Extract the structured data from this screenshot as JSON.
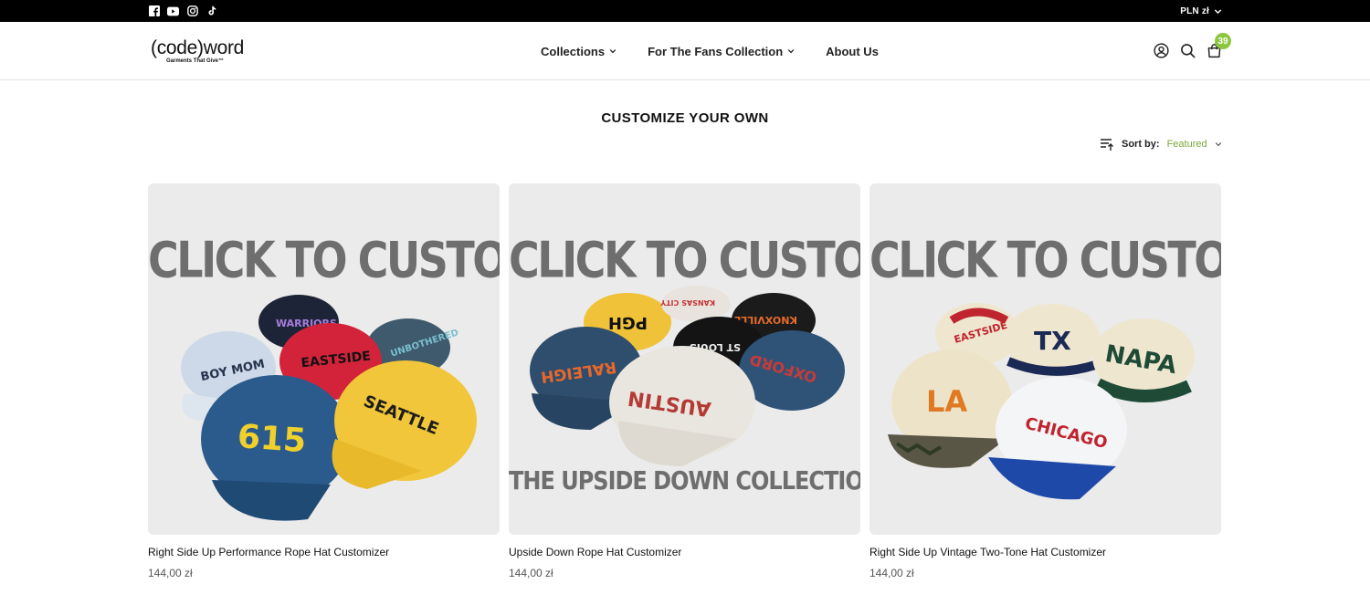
{
  "topbar": {
    "social_icons": [
      "facebook-icon",
      "youtube-icon",
      "instagram-icon",
      "tiktok-icon"
    ],
    "currency": "PLN zł"
  },
  "header": {
    "logo": "(code)word",
    "logo_tagline": "Garments That Give™",
    "nav": [
      {
        "label": "Collections",
        "has_dropdown": true
      },
      {
        "label": "For The Fans Collection",
        "has_dropdown": true
      },
      {
        "label": "About Us",
        "has_dropdown": false
      }
    ],
    "icons": [
      "account-icon",
      "search-icon",
      "cart-icon"
    ],
    "cart_count": "39"
  },
  "page": {
    "title": "CUSTOMIZE YOUR OWN",
    "sort_label": "Sort by:",
    "sort_value": "Featured"
  },
  "products": [
    {
      "headline": "CLICK TO CUSTOMIZE",
      "subline": "",
      "name": "Right Side Up Performance Rope Hat Customizer",
      "price": "144,00 zł",
      "hats": [
        "BOY MOM",
        "WARRIORS",
        "EASTSIDE",
        "UNBOTHERED",
        "615",
        "SEATTLE"
      ]
    },
    {
      "headline": "CLICK TO CUSTOMIZE",
      "subline": "THE UPSIDE DOWN COLLECTION",
      "name": "Upside Down Rope Hat Customizer",
      "price": "144,00 zł",
      "hats": [
        "PGH",
        "KANSAS CITY",
        "KNOXVILLE",
        "RALEIGH",
        "ST LOUIS",
        "OXFORD",
        "AUSTIN"
      ]
    },
    {
      "headline": "CLICK TO CUSTOMIZE",
      "subline": "",
      "name": "Right Side Up Vintage Two-Tone Hat Customizer",
      "price": "144,00 zł",
      "hats": [
        "EASTSIDE",
        "TX",
        "NAPA",
        "LA",
        "CHICAGO"
      ]
    }
  ],
  "colors": {
    "accent": "#8cc63e",
    "sort_value": "#7ea63a",
    "topbar": "#000000"
  }
}
